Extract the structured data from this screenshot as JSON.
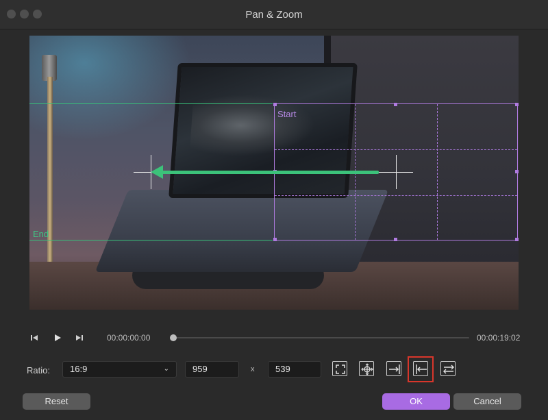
{
  "window": {
    "title": "Pan & Zoom"
  },
  "preview": {
    "start_label": "Start",
    "end_label": "End",
    "colors": {
      "start_box": "#b07be0",
      "end_box": "#38c17a",
      "arrow": "#3cc27a"
    }
  },
  "timeline": {
    "current_time": "00:00:00:00",
    "total_time": "00:00:19:02",
    "progress": 0
  },
  "ratio": {
    "label": "Ratio:",
    "selected": "16:9",
    "width": "959",
    "separator": "x",
    "height": "539"
  },
  "tools": [
    {
      "icon": "fit-frame-icon"
    },
    {
      "icon": "center-move-icon"
    },
    {
      "icon": "move-right-icon"
    },
    {
      "icon": "move-left-icon",
      "selected": true
    },
    {
      "icon": "swap-icon"
    }
  ],
  "buttons": {
    "reset": "Reset",
    "ok": "OK",
    "cancel": "Cancel"
  },
  "accent_color": "#a86be3",
  "highlight_color": "#d9362b"
}
